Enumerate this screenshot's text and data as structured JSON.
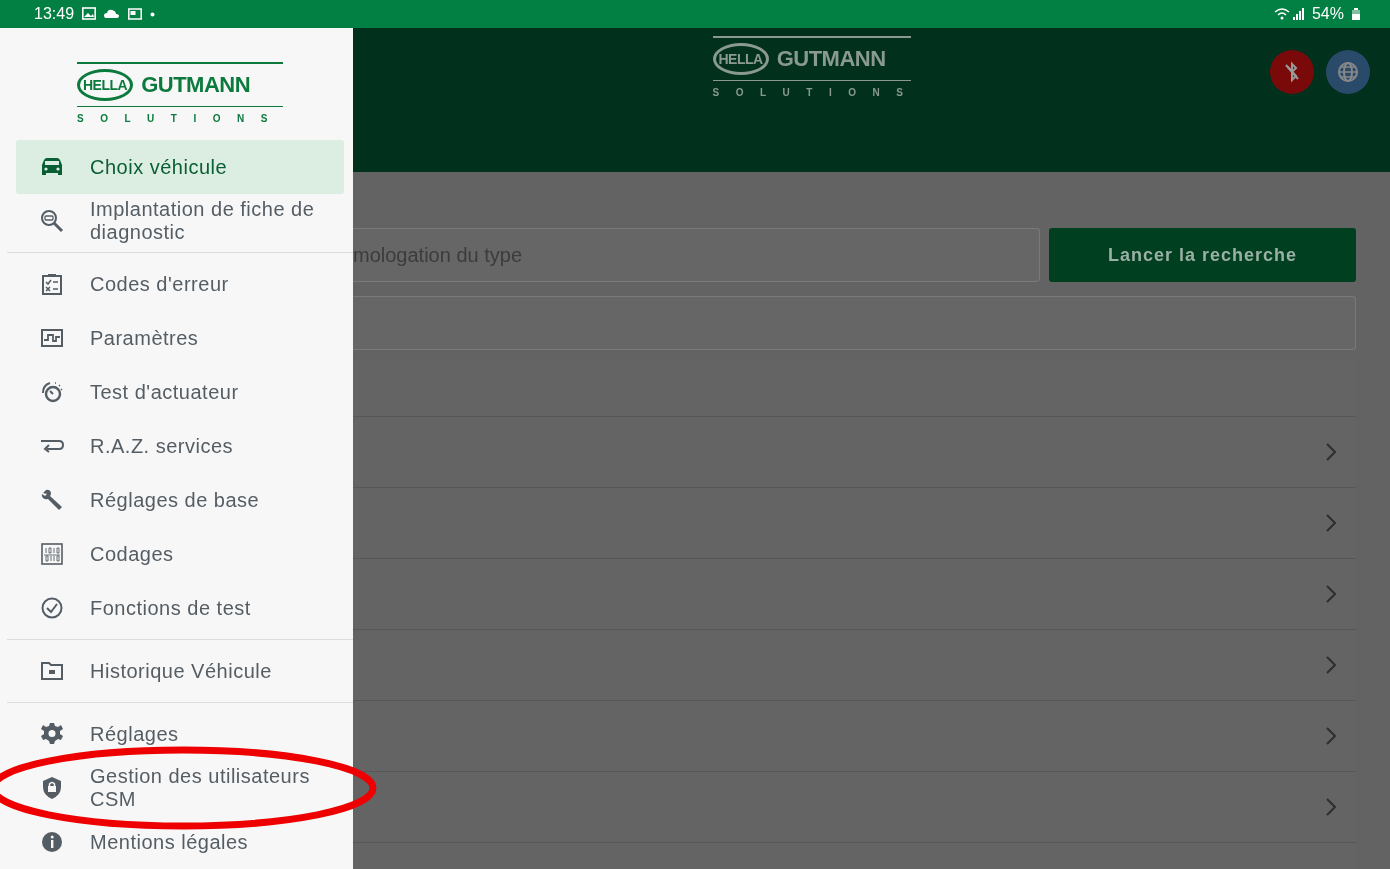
{
  "status_bar": {
    "time": "13:49",
    "battery": "54%"
  },
  "header": {
    "logo": {
      "brand": "HELLA",
      "name": "GUTMANN",
      "tagline": "SOLUTIONS"
    }
  },
  "search": {
    "placeholder": "mologation du type",
    "button": "Lancer la recherche"
  },
  "drawer": {
    "logo": {
      "brand": "HELLA",
      "name": "GUTMANN",
      "tagline": "SOLUTIONS"
    },
    "sections": [
      [
        {
          "label": "Choix véhicule",
          "selected": true
        },
        {
          "label": "Implantation de fiche de diagnostic",
          "selected": false
        }
      ],
      [
        {
          "label": "Codes d'erreur",
          "selected": false
        },
        {
          "label": "Paramètres",
          "selected": false
        },
        {
          "label": "Test d'actuateur",
          "selected": false
        },
        {
          "label": "R.A.Z. services",
          "selected": false
        },
        {
          "label": "Réglages de base",
          "selected": false
        },
        {
          "label": "Codages",
          "selected": false
        },
        {
          "label": "Fonctions de test",
          "selected": false
        }
      ],
      [
        {
          "label": "Historique Véhicule",
          "selected": false
        }
      ],
      [
        {
          "label": "Réglages",
          "selected": false
        },
        {
          "label": "Gestion des utilisateurs CSM",
          "selected": false,
          "highlighted": true
        },
        {
          "label": "Mentions légales",
          "selected": false
        }
      ]
    ]
  }
}
